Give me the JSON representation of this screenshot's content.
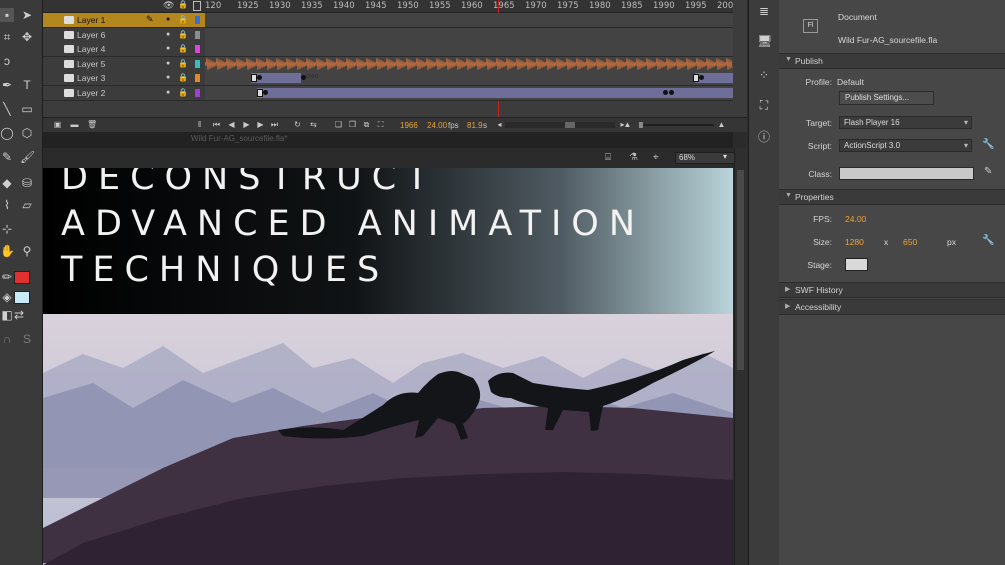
{
  "timeline": {
    "ruler_ticks": [
      "120",
      "1925",
      "1930",
      "1935",
      "1940",
      "1945",
      "1950",
      "1955",
      "1960",
      "1965",
      "1970",
      "1975",
      "1980",
      "1985",
      "1990",
      "1995",
      "200"
    ],
    "layers": [
      {
        "name": "Layer 1",
        "color": "#3a6fd0",
        "selected": true
      },
      {
        "name": "Layer 6",
        "color": "#8c8c8c",
        "selected": false
      },
      {
        "name": "Layer 4",
        "color": "#e040e0",
        "selected": false
      },
      {
        "name": "Layer 5",
        "color": "#34c0c0",
        "selected": false
      },
      {
        "name": "Layer 3",
        "color": "#e08a20",
        "selected": false
      },
      {
        "name": "Layer 2",
        "color": "#a040d0",
        "selected": false
      }
    ],
    "current_frame": "1966",
    "fps": "24.00",
    "fps_unit": "fps",
    "elapsed": "81.9",
    "elapsed_unit": "s"
  },
  "document_tabs": [
    "Wild Fur-AG_sourcefile.fla*"
  ],
  "stage": {
    "zoom": "68%",
    "headline_lines": [
      "DECONSTRUCT",
      "ADVANCED ANIMATION",
      "TECHNIQUES"
    ]
  },
  "properties": {
    "doc_type": "Document",
    "doc_icon_label": "Fl",
    "file_name": "Wild Fur-AG_sourcefile.fla",
    "publish_section": "Publish",
    "profile_label": "Profile:",
    "profile_value": "Default",
    "publish_settings_button": "Publish Settings...",
    "target_label": "Target:",
    "target_value": "Flash Player 16",
    "script_label": "Script:",
    "script_value": "ActionScript 3.0",
    "class_label": "Class:",
    "properties_section": "Properties",
    "fps_label": "FPS:",
    "fps_value": "24.00",
    "size_label": "Size:",
    "width_value": "1280",
    "x_sep": "x",
    "height_value": "650",
    "size_unit": "px",
    "stage_label": "Stage:",
    "stage_color": "#d9d9d9",
    "swf_history_section": "SWF History",
    "accessibility_section": "Accessibility"
  }
}
